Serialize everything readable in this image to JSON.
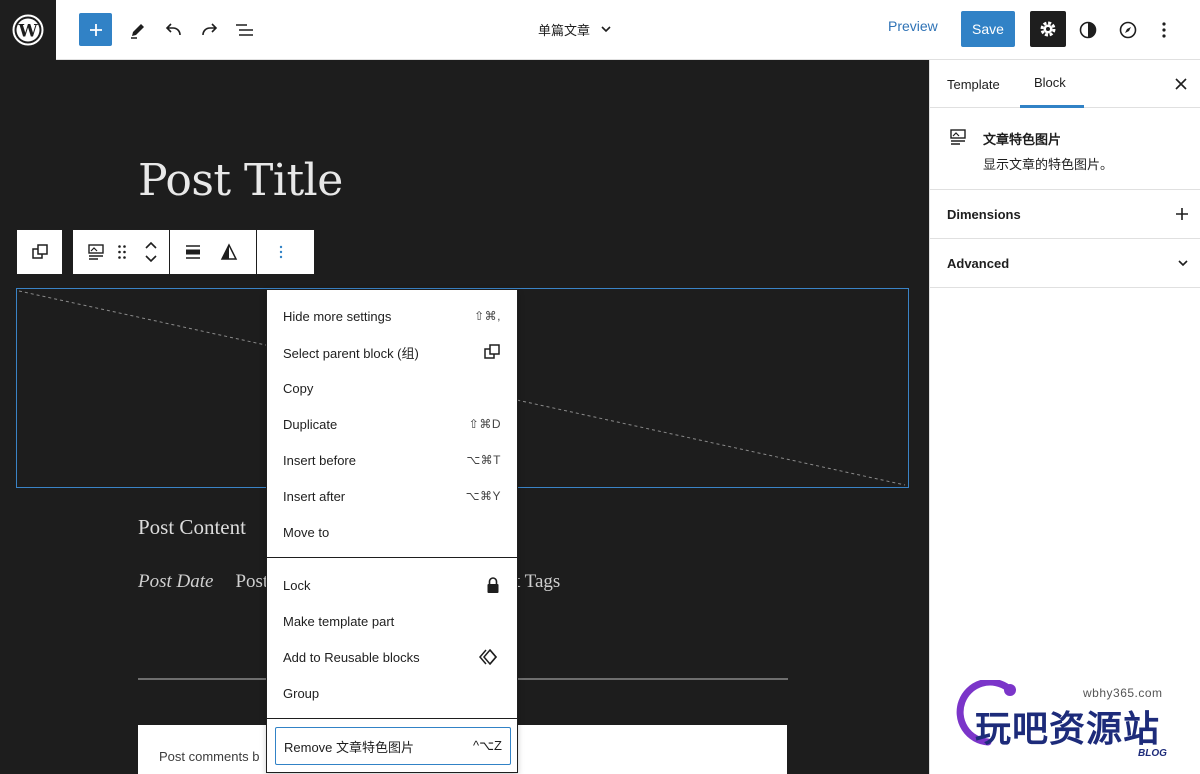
{
  "header": {
    "doc_title": "单篇文章",
    "preview_label": "Preview",
    "save_label": "Save"
  },
  "canvas": {
    "post_title": "Post Title",
    "post_content": "Post Content",
    "post_date": "Post Date",
    "post_author_partial": "Post",
    "post_tags_partial": "t Tags",
    "comments_partial": "Post comments b"
  },
  "menu": {
    "items": [
      {
        "label": "Hide more settings",
        "shortcut": "⇧⌘,"
      },
      {
        "label": "Select parent block (组)",
        "shortcut": ""
      },
      {
        "label": "Copy",
        "shortcut": ""
      },
      {
        "label": "Duplicate",
        "shortcut": "⇧⌘D"
      },
      {
        "label": "Insert before",
        "shortcut": "⌥⌘T"
      },
      {
        "label": "Insert after",
        "shortcut": "⌥⌘Y"
      },
      {
        "label": "Move to",
        "shortcut": ""
      }
    ],
    "items2": [
      {
        "label": "Lock",
        "shortcut": ""
      },
      {
        "label": "Make template part",
        "shortcut": ""
      },
      {
        "label": "Add to Reusable blocks",
        "shortcut": ""
      },
      {
        "label": "Group",
        "shortcut": ""
      }
    ],
    "remove": {
      "label": "Remove 文章特色图片",
      "shortcut": "^⌥Z"
    }
  },
  "sidebar": {
    "tabs": [
      {
        "label": "Template"
      },
      {
        "label": "Block"
      }
    ],
    "active_tab": "Block",
    "block_title": "文章特色图片",
    "block_desc": "显示文章的特色图片。",
    "panels": [
      {
        "label": "Dimensions"
      },
      {
        "label": "Advanced"
      }
    ]
  },
  "watermark": {
    "url": "wbhy365.com",
    "name": "玩吧资源站",
    "blog": "BLOG"
  },
  "colors": {
    "accent": "#3182c6",
    "canvas_bg": "#1d1d1d",
    "dark": "#1e1e1e"
  }
}
